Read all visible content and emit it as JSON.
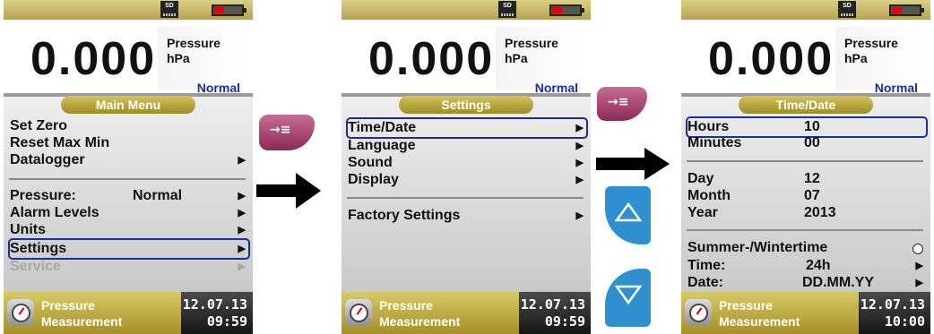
{
  "screens": [
    {
      "reading": "0.000",
      "quantity": "Pressure",
      "unit": "hPa",
      "mode": "Normal",
      "menu_title": "Main Menu",
      "items": [
        {
          "label": "Set Zero"
        },
        {
          "label": "Reset Max Min"
        },
        {
          "label": "Datalogger"
        },
        {
          "label": "Pressure:",
          "value": "Normal"
        },
        {
          "label": "Alarm Levels"
        },
        {
          "label": "Units"
        },
        {
          "label": "Settings"
        },
        {
          "label": "Service"
        }
      ],
      "status_title": "Pressure",
      "status_sub": "Measurement",
      "date": "12.07.13",
      "time": "09:59"
    },
    {
      "reading": "0.000",
      "quantity": "Pressure",
      "unit": "hPa",
      "mode": "Normal",
      "menu_title": "Settings",
      "items": [
        {
          "label": "Time/Date"
        },
        {
          "label": "Language"
        },
        {
          "label": "Sound"
        },
        {
          "label": "Display"
        },
        {
          "label": "Factory Settings"
        }
      ],
      "status_title": "Pressure",
      "status_sub": "Measurement",
      "date": "12.07.13",
      "time": "09:59"
    },
    {
      "reading": "0.000",
      "quantity": "Pressure",
      "unit": "hPa",
      "mode": "Normal",
      "menu_title": "Time/Date",
      "items": [
        {
          "label": "Hours",
          "value": "10"
        },
        {
          "label": "Minutes",
          "value": "00"
        },
        {
          "label": "Day",
          "value": "12"
        },
        {
          "label": "Month",
          "value": "07"
        },
        {
          "label": "Year",
          "value": "2013"
        },
        {
          "label": "Summer-/Wintertime"
        },
        {
          "label": "Time:",
          "value": "24h"
        },
        {
          "label": "Date:",
          "value": "DD.MM.YY"
        }
      ],
      "status_title": "Pressure",
      "status_sub": "Measurement",
      "date": "12.07.13",
      "time": "10:00"
    }
  ],
  "sd_card_label": "SD",
  "icons": {
    "enter_key": "enter-key-icon",
    "up_key": "up-arrow-icon",
    "down_key": "down-arrow-icon",
    "flow_arrow": "right-arrow-icon",
    "sd_card": "sd-card-icon",
    "battery": "battery-low-icon",
    "gauge": "pressure-gauge-icon"
  },
  "colors": {
    "bar_gold": "#b6a44a",
    "highlight_blue": "#1a2f9a",
    "battery_red": "#e00000",
    "key_magenta": "#a8416f",
    "key_blue": "#2f90cf"
  }
}
